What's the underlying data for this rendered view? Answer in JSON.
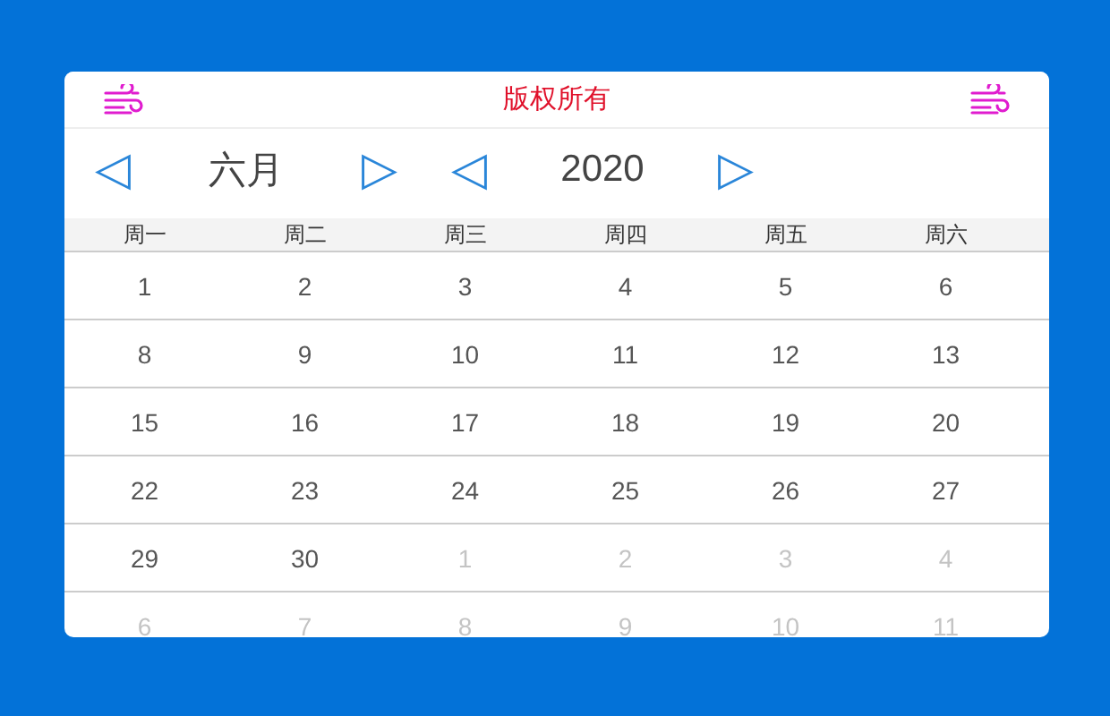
{
  "header": {
    "title": "版权所有"
  },
  "nav": {
    "month": "六月",
    "year": "2020",
    "prev": "◁",
    "next": "▷"
  },
  "weekdays": [
    "周一",
    "周二",
    "周三",
    "周四",
    "周五",
    "周六"
  ],
  "weeks": [
    [
      {
        "day": "1",
        "faded": false
      },
      {
        "day": "2",
        "faded": false
      },
      {
        "day": "3",
        "faded": false
      },
      {
        "day": "4",
        "faded": false
      },
      {
        "day": "5",
        "faded": false
      },
      {
        "day": "6",
        "faded": false
      }
    ],
    [
      {
        "day": "8",
        "faded": false
      },
      {
        "day": "9",
        "faded": false
      },
      {
        "day": "10",
        "faded": false
      },
      {
        "day": "11",
        "faded": false
      },
      {
        "day": "12",
        "faded": false
      },
      {
        "day": "13",
        "faded": false
      }
    ],
    [
      {
        "day": "15",
        "faded": false
      },
      {
        "day": "16",
        "faded": false
      },
      {
        "day": "17",
        "faded": false
      },
      {
        "day": "18",
        "faded": false
      },
      {
        "day": "19",
        "faded": false
      },
      {
        "day": "20",
        "faded": false
      }
    ],
    [
      {
        "day": "22",
        "faded": false
      },
      {
        "day": "23",
        "faded": false
      },
      {
        "day": "24",
        "faded": false
      },
      {
        "day": "25",
        "faded": false
      },
      {
        "day": "26",
        "faded": false
      },
      {
        "day": "27",
        "faded": false
      }
    ],
    [
      {
        "day": "29",
        "faded": false
      },
      {
        "day": "30",
        "faded": false
      },
      {
        "day": "1",
        "faded": true
      },
      {
        "day": "2",
        "faded": true
      },
      {
        "day": "3",
        "faded": true
      },
      {
        "day": "4",
        "faded": true
      }
    ],
    [
      {
        "day": "6",
        "faded": true
      },
      {
        "day": "7",
        "faded": true
      },
      {
        "day": "8",
        "faded": true
      },
      {
        "day": "9",
        "faded": true
      },
      {
        "day": "10",
        "faded": true
      },
      {
        "day": "11",
        "faded": true
      }
    ]
  ]
}
